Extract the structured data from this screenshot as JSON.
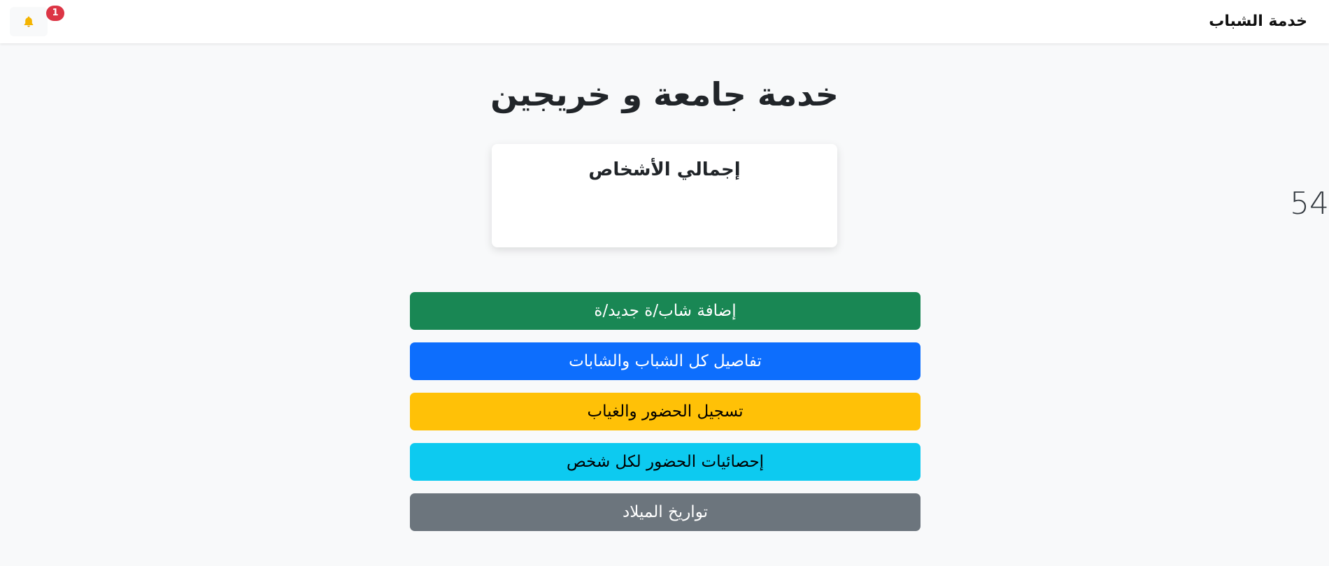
{
  "navbar": {
    "brand": "خدمة الشباب",
    "notifications": {
      "icon": "bell-icon",
      "count": "1"
    }
  },
  "main": {
    "title": "خدمة جامعة و خريجين",
    "stats": {
      "label": "إجمالي الأشخاص",
      "value": "54"
    },
    "actions": [
      {
        "label": "إضافة شاب/ة جديد/ة",
        "color": "#198754"
      },
      {
        "label": "تفاصيل كل الشباب والشابات",
        "color": "#0d6efd"
      },
      {
        "label": "تسجيل الحضور والغياب",
        "color": "#ffc107"
      },
      {
        "label": "إحصائيات الحضور لكل شخص",
        "color": "#0dcaf0"
      },
      {
        "label": "تواريخ الميلاد",
        "color": "#6c757d"
      }
    ]
  }
}
